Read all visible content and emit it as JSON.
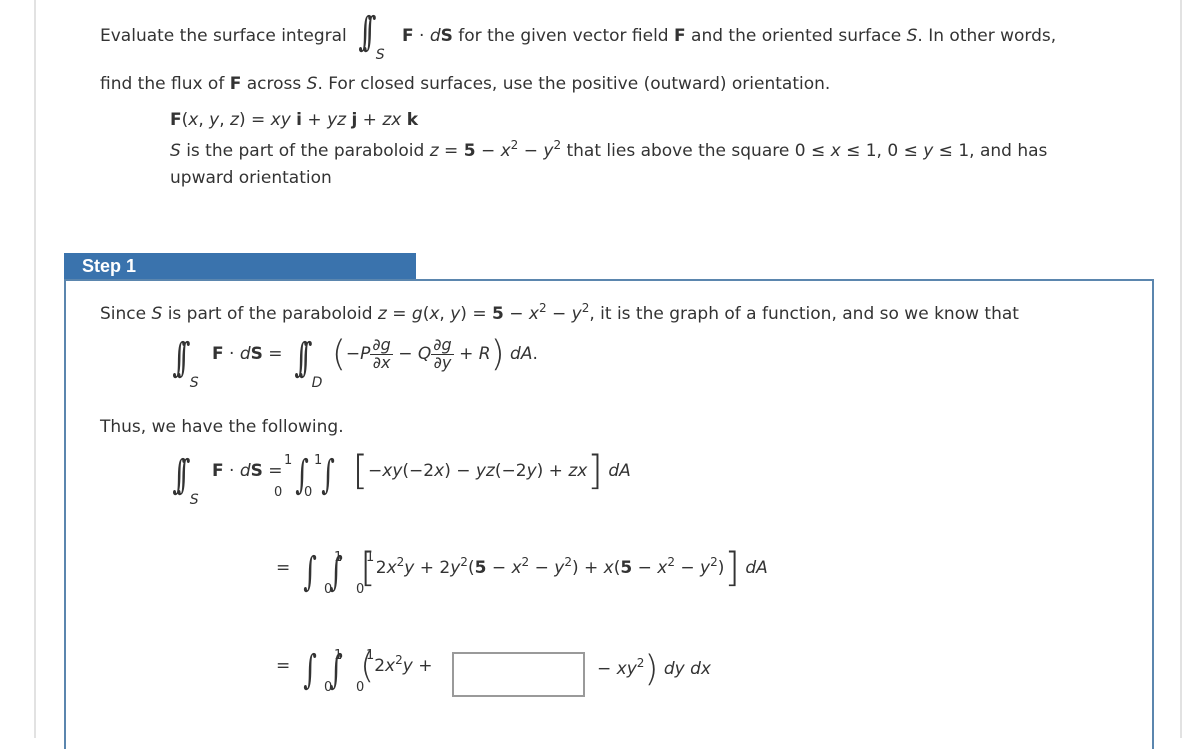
{
  "problem": {
    "intro_before": "Evaluate the surface integral",
    "integrand": "F · dS",
    "intro_after": "for the given vector field F and the oriented surface S. In other words,",
    "line2": "find the flux of F across S. For closed surfaces, use the positive (outward) orientation.",
    "field": "F(x, y, z) = xy i + yz j + zx k",
    "surface_line1": "S is the part of the paraboloid z = 5 − x² − y² that lies above the square 0 ≤ x ≤ 1, 0 ≤ y ≤ 1, and has",
    "surface_line2": "upward orientation"
  },
  "step": {
    "label": "Step 1",
    "sentence": "Since S is part of the paraboloid z = g(x, y) = 5 − x² − y², it is the graph of a function, and so we know that",
    "formula": "∬_S F · dS = ∬_D (−P ∂g/∂x − Q ∂g/∂y + R) dA.",
    "thus": "Thus, we have the following.",
    "line1": "∬_S F · dS = ∫₀¹∫₀¹ [−xy(−2x) − yz(−2y) + zx] dA",
    "line2": "= ∫₀¹∫₀¹ [2x²y + 2y²(5 − x² − y²) + x(5 − x² − y²)] dA",
    "line3_before": "= ∫₀¹∫₀¹ (2x²y +",
    "line3_after": "− xy²) dy dx",
    "answer_value": ""
  },
  "colors": {
    "step_header": "#3a73ad",
    "step_border": "#5b86ae",
    "text": "#333333"
  }
}
